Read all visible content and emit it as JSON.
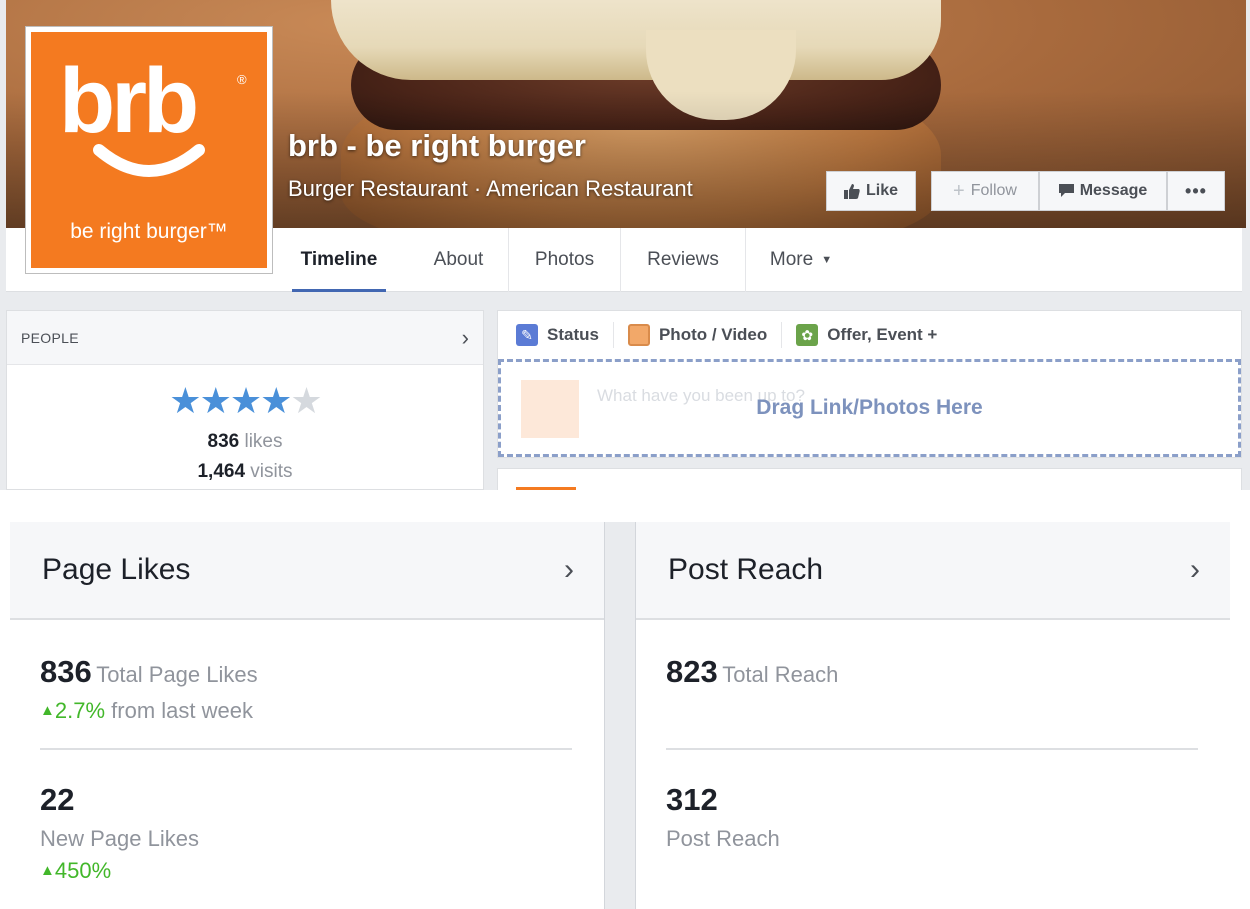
{
  "page": {
    "name": "brb - be right burger",
    "category": "Burger Restaurant · American Restaurant",
    "logo_text": "brb",
    "logo_tagline": "be right burger™",
    "logo_reg": "®"
  },
  "cover_buttons": {
    "like": "Like",
    "follow": "Follow",
    "message": "Message",
    "more": "•••"
  },
  "tabs": [
    {
      "label": "Timeline",
      "active": true
    },
    {
      "label": "About"
    },
    {
      "label": "Photos"
    },
    {
      "label": "Reviews"
    },
    {
      "label": "More"
    }
  ],
  "people": {
    "title": "PEOPLE",
    "rating": 4,
    "rating_max": 5,
    "likes_count": "836",
    "likes_label": "likes",
    "visits_count": "1,464",
    "visits_label": "visits"
  },
  "composer": {
    "tab_status": "Status",
    "tab_photo": "Photo / Video",
    "tab_offer": "Offer, Event +",
    "placeholder": "What have you been up to?",
    "drop_label": "Drag Link/Photos Here"
  },
  "insights": {
    "page_likes": {
      "title": "Page Likes",
      "total_value": "836",
      "total_label": "Total Page Likes",
      "total_change": "2.7%",
      "total_change_suffix": "from last week",
      "new_value": "22",
      "new_label": "New Page Likes",
      "new_change": "450%"
    },
    "post_reach": {
      "title": "Post Reach",
      "total_value": "823",
      "total_label": "Total Reach",
      "post_value": "312",
      "post_label": "Post Reach"
    }
  },
  "colors": {
    "brand_orange": "#f47a20",
    "facebook_blue": "#4267b2",
    "positive_green": "#42b72a",
    "star_blue": "#4a90d9"
  }
}
